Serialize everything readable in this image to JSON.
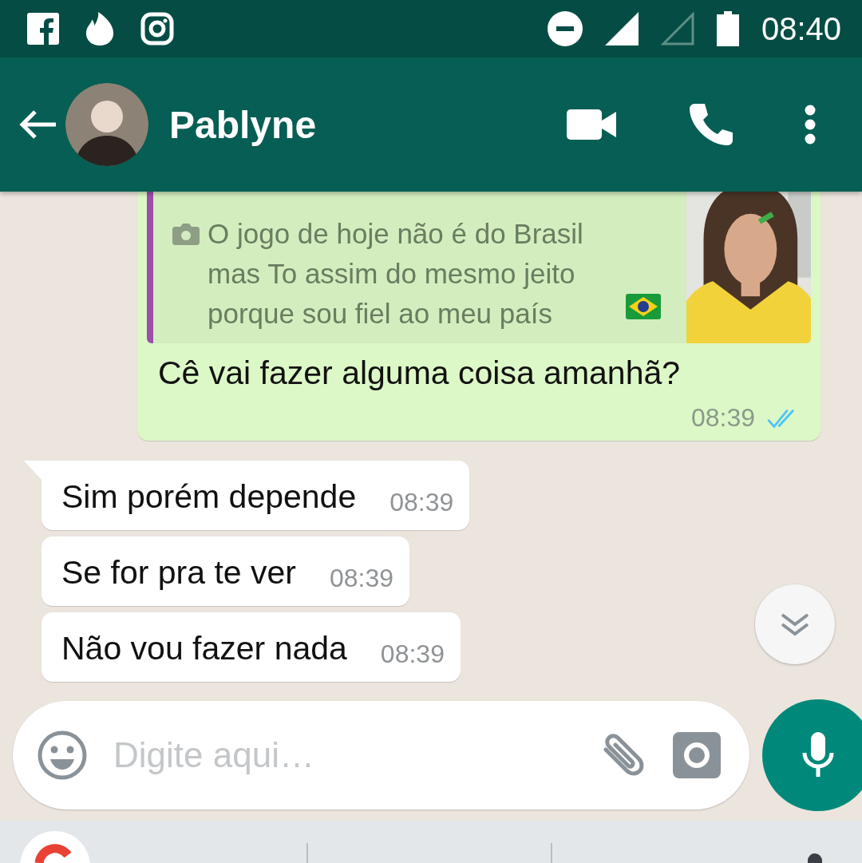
{
  "status_bar": {
    "time": "08:40"
  },
  "header": {
    "contact_name": "Pablyne"
  },
  "messages": [
    {
      "kind": "outgoing",
      "quote": {
        "text": "O jogo de hoje não é do Brasil mas To assim do mesmo jeito porque sou fiel ao meu país"
      },
      "text": "Cê vai fazer alguma coisa amanhã?",
      "time": "08:39",
      "read": true
    },
    {
      "kind": "incoming",
      "text": "Sim porém depende",
      "time": "08:39",
      "tail": true
    },
    {
      "kind": "incoming",
      "text": "Se for pra te ver",
      "time": "08:39",
      "tail": false
    },
    {
      "kind": "incoming",
      "text": "Não vou fazer nada",
      "time": "08:39",
      "tail": false
    }
  ],
  "composer": {
    "placeholder": "Digite aqui…"
  }
}
